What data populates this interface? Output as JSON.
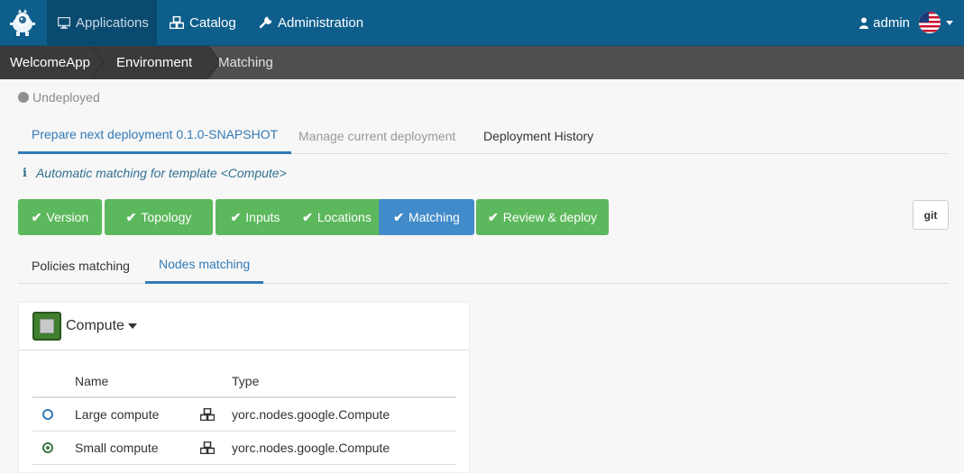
{
  "navbar": {
    "items": [
      {
        "label": "Applications",
        "icon": "desktop-icon",
        "active": true
      },
      {
        "label": "Catalog",
        "icon": "cubes-icon"
      },
      {
        "label": "Administration",
        "icon": "wrench-icon"
      }
    ],
    "user": "admin",
    "flag_icon": "us-flag-icon"
  },
  "breadcrumb": [
    "WelcomeApp",
    "Environment",
    "Matching"
  ],
  "status": "Undeployed",
  "deploy_tabs": [
    "Prepare next deployment 0.1.0-SNAPSHOT",
    "Manage current deployment",
    "Deployment History"
  ],
  "info": "Automatic matching for template <Compute>",
  "steps": [
    "Version",
    "Topology",
    "Inputs",
    "Locations",
    "Matching",
    "Review & deploy"
  ],
  "git_label": "git",
  "match_tabs": [
    "Policies matching",
    "Nodes matching"
  ],
  "panel": {
    "title": "Compute",
    "columns": [
      "Name",
      "Type"
    ],
    "rows": [
      {
        "name": "Large compute",
        "type": "yorc.nodes.google.Compute",
        "selected": false
      },
      {
        "name": "Small compute",
        "type": "yorc.nodes.google.Compute",
        "selected": true
      }
    ]
  },
  "colors": {
    "navbar": "#0e5e8c",
    "step_done": "#5cb85c",
    "step_active": "#428bca",
    "link": "#337ab7"
  }
}
